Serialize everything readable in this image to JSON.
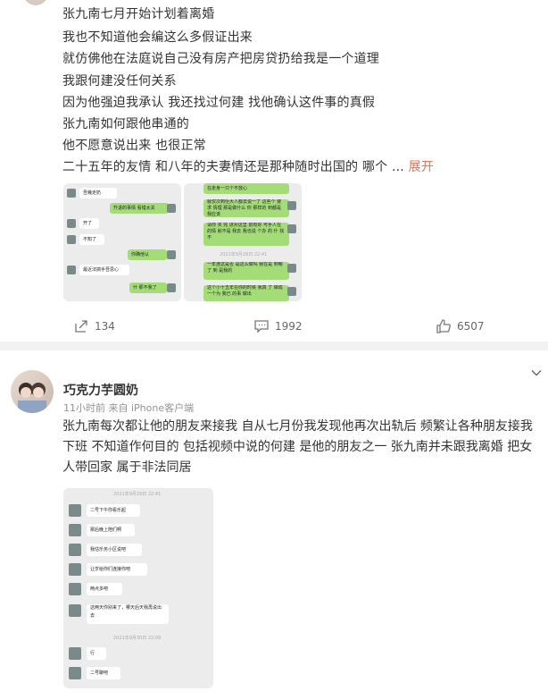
{
  "post1": {
    "lines": [
      "张九南七月开始计划着离婚",
      "我也不知道他会编这么多假证出来",
      "就仿佛他在法庭说自己没有房产把房贷扔给我是一个道理",
      "我跟何建没任何关系",
      "因为他强迫我承认 我还找过何建 找他确认这件事的真假",
      "张九南如何跟他串通的",
      "他不愿意说出来 也很正常",
      "二十五年的友情 和八年的夫妻情还是那种随时出国的 哪个 ..."
    ],
    "expand_label": "展开",
    "img1": {
      "left": [
        "吾幾走奶",
        "开了",
        "不知了",
        "最近法搞手吾思心"
      ],
      "right": [
        "升退的事情 看错太关",
        "你确他认",
        "什 那不我了"
      ]
    },
    "img2": {
      "right": [
        "在走身一只个不放心",
        "就仅次到佢大人都去说一了 这些个 要求 情理 那是做什么 你 那样的 到都是 我应该",
        "请你 买 完 进对这里 前有好 可手人在 的情 就不是 我去 我也说 个办 的 什 找不",
        "一年连这是否 是这么做吗 我在是 到哪了 到 是我的",
        "这个小十五年在你的时侯 我真 了 做成一个为 我已 的事 做出"
      ],
      "timestamp": "2021年9月26日 22:41"
    },
    "share_count": "134",
    "comment_count": "1992",
    "like_count": "6507"
  },
  "post2": {
    "username": "巧克力芋圆奶",
    "meta": "11小时前 来自 iPhone客户端",
    "text": "张九南每次都让他的朋友来接我 自从七月份我发现他再次出轨后 频繁让各种朋友接我下班 不知道作何目的 包括视频中说的何建 是他的朋友之一 张九南并未跟我离婚 把女人带回家 属于非法同居",
    "shot": {
      "timestamp_top": "2021年9月29日 22:41",
      "msgs": [
        "二号下午你看乐起",
        "那后晚上陪们啊",
        "我估乐务小区说吧",
        "让岁给你们连接你吧",
        "两点多吧",
        "这两天你别来了，哪天后天我再说出去"
      ],
      "timestamp_mid": "2021年9月30日 22:09",
      "msgs2": [
        "行",
        "二号聊吧"
      ]
    }
  },
  "colors": {
    "accent": "#eb7350",
    "meta": "#939393",
    "bubble_green": "#a4dc78"
  },
  "icons": [
    "share-icon",
    "comment-icon",
    "like-icon",
    "chevron-down-icon"
  ]
}
